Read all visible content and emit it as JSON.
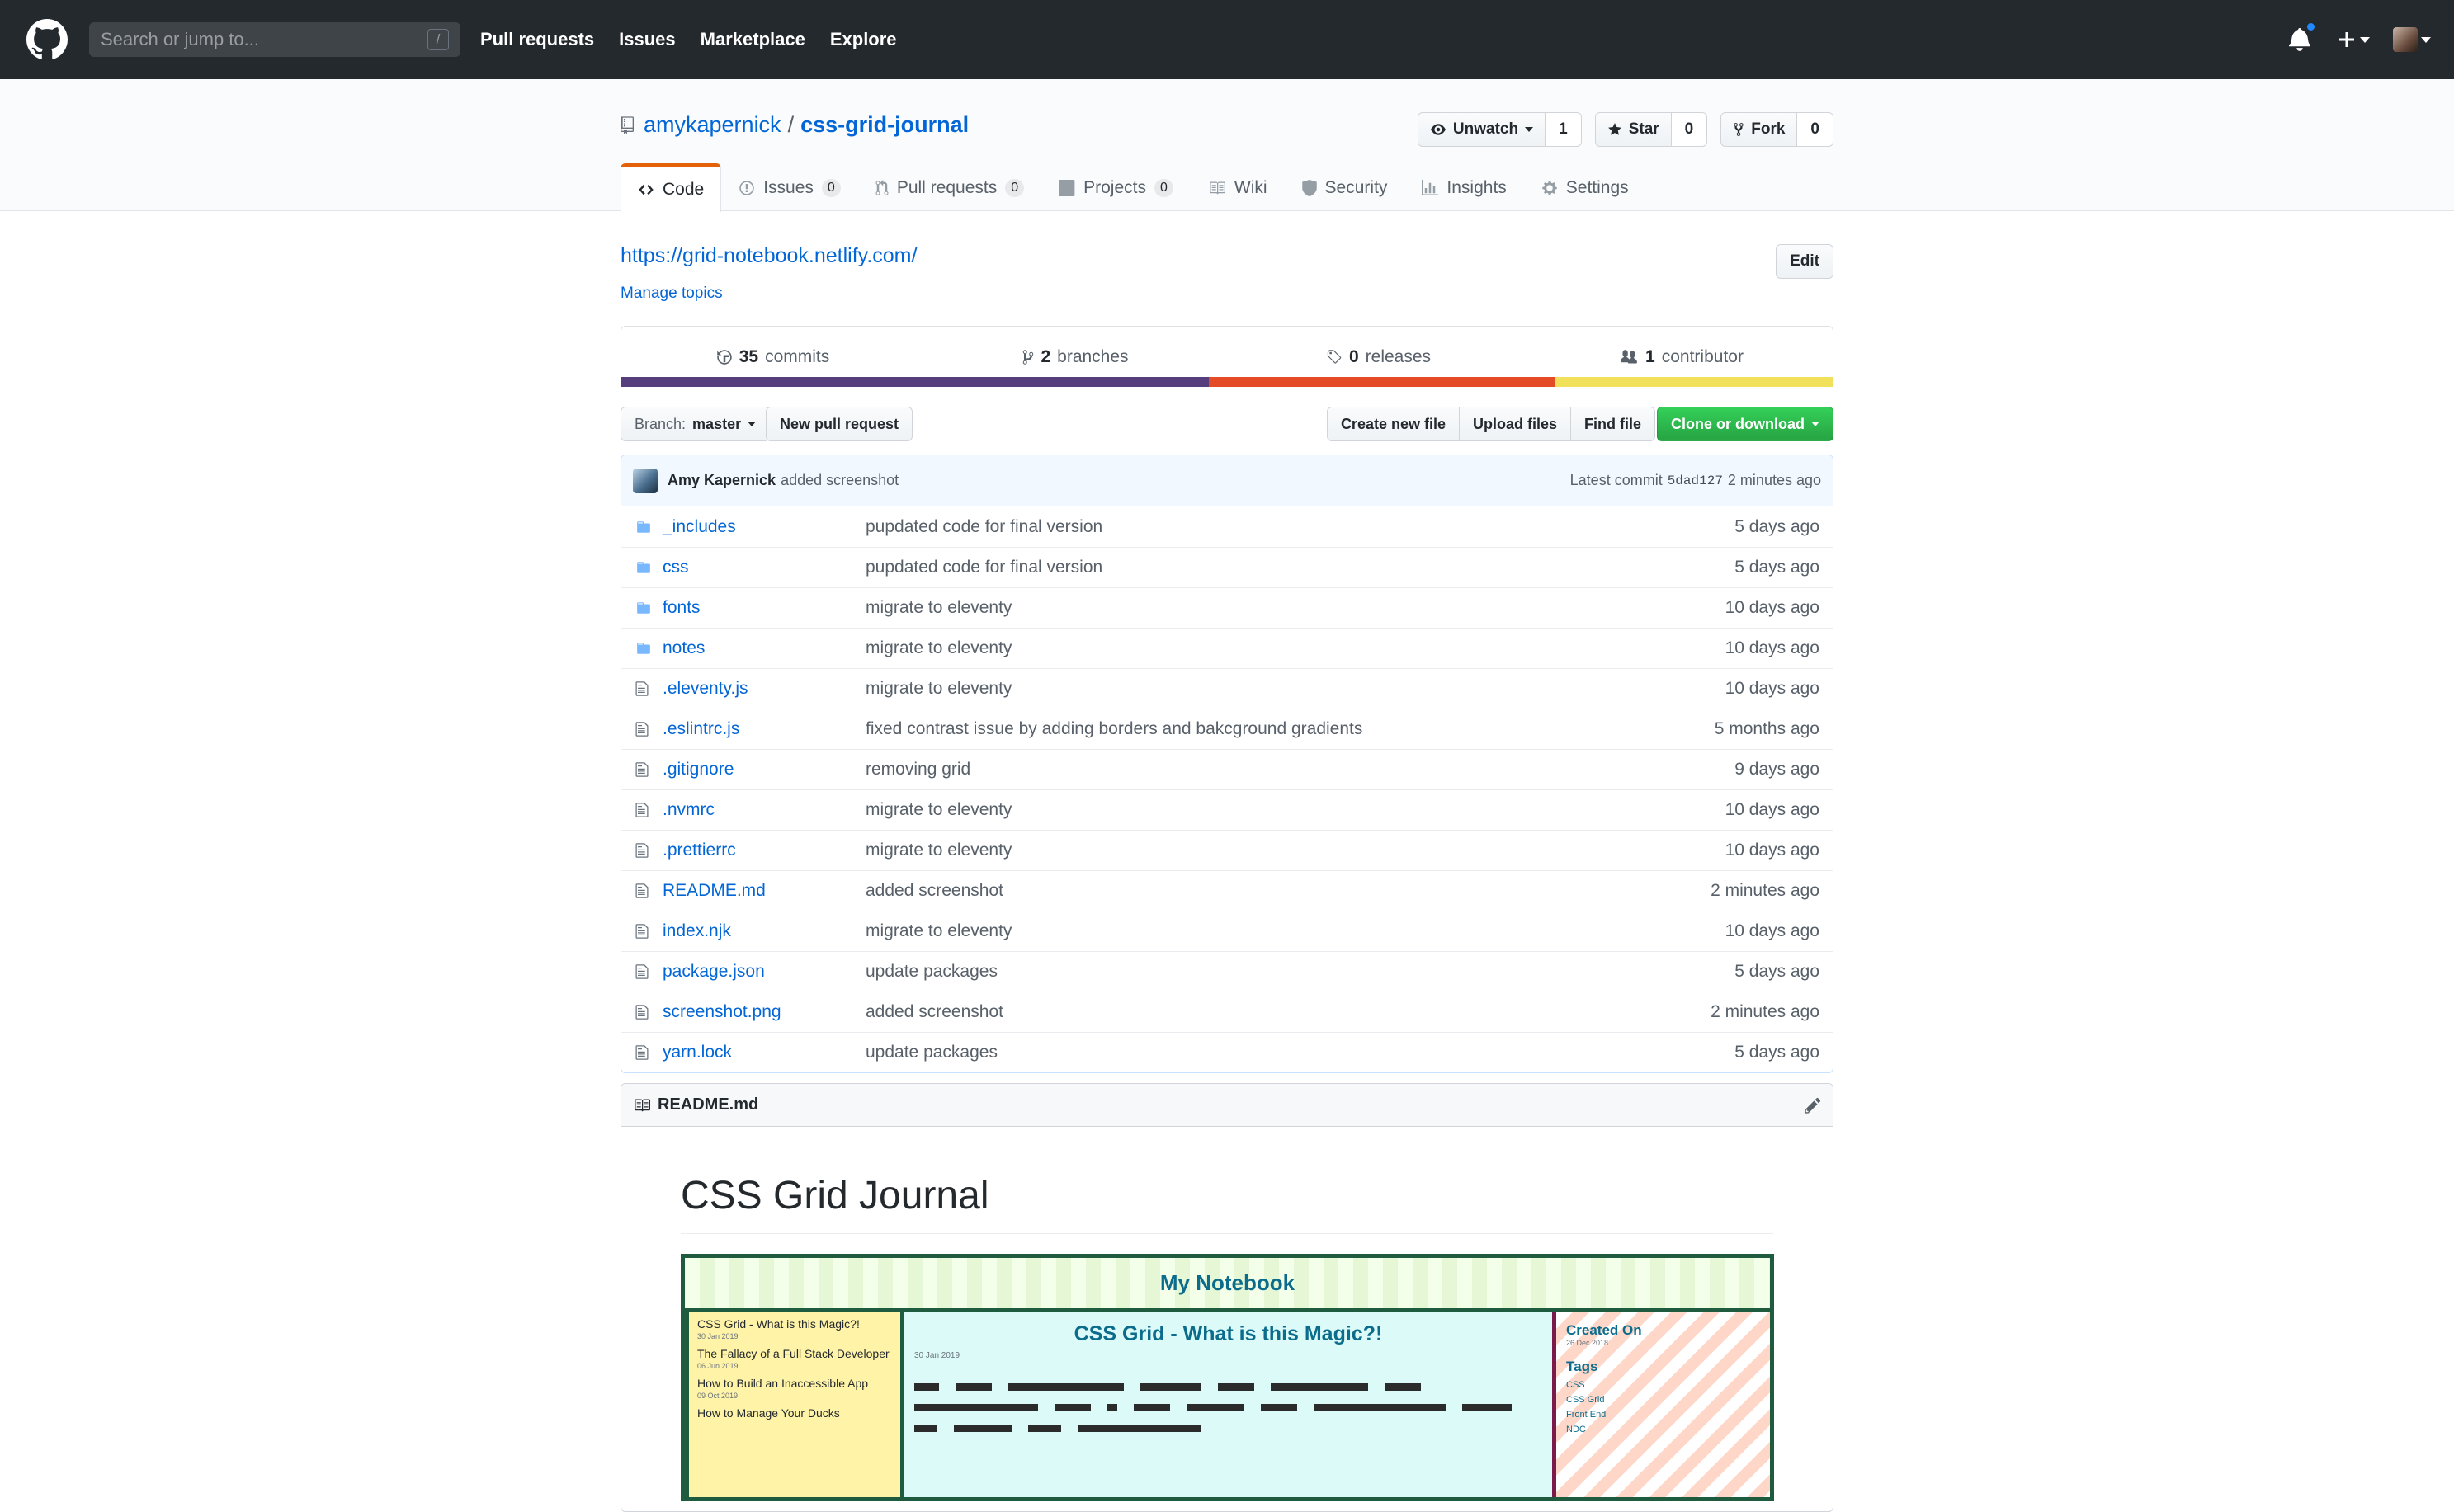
{
  "header": {
    "search_placeholder": "Search or jump to...",
    "slash_key": "/",
    "nav": [
      "Pull requests",
      "Issues",
      "Marketplace",
      "Explore"
    ]
  },
  "repo": {
    "owner": "amykapernick",
    "separator": "/",
    "name": "css-grid-journal",
    "actions": {
      "watch_label": "Unwatch",
      "watch_count": "1",
      "star_label": "Star",
      "star_count": "0",
      "fork_label": "Fork",
      "fork_count": "0"
    },
    "tabs": [
      {
        "label": "Code",
        "count": null,
        "icon": "code-icon"
      },
      {
        "label": "Issues",
        "count": "0",
        "icon": "issue-icon"
      },
      {
        "label": "Pull requests",
        "count": "0",
        "icon": "pull-request-icon"
      },
      {
        "label": "Projects",
        "count": "0",
        "icon": "project-icon"
      },
      {
        "label": "Wiki",
        "count": null,
        "icon": "book-icon"
      },
      {
        "label": "Security",
        "count": null,
        "icon": "shield-icon"
      },
      {
        "label": "Insights",
        "count": null,
        "icon": "graph-icon"
      },
      {
        "label": "Settings",
        "count": null,
        "icon": "gear-icon"
      }
    ]
  },
  "main": {
    "website": "https://grid-notebook.netlify.com/",
    "edit_label": "Edit",
    "manage_topics": "Manage topics",
    "numbers": {
      "commits_count": "35",
      "commits_label": "commits",
      "branches_count": "2",
      "branches_label": "branches",
      "releases_count": "0",
      "releases_label": "releases",
      "contributors_count": "1",
      "contributors_label": "contributor"
    },
    "languages": [
      {
        "color": "#563d7c",
        "percent": 48.5
      },
      {
        "color": "#e34c26",
        "percent": 28.6
      },
      {
        "color": "#f1e05a",
        "percent": 22.9
      }
    ],
    "branch_prefix": "Branch:",
    "branch_name": "master",
    "new_pr": "New pull request",
    "create_file": "Create new file",
    "upload_files": "Upload files",
    "find_file": "Find file",
    "clone": "Clone or download",
    "commit": {
      "author": "Amy Kapernick",
      "message": "added screenshot",
      "latest_label": "Latest commit",
      "sha": "5dad127",
      "age": "2 minutes ago"
    },
    "files": [
      {
        "type": "dir",
        "name": "_includes",
        "message": "pupdated code for final version",
        "age": "5 days ago"
      },
      {
        "type": "dir",
        "name": "css",
        "message": "pupdated code for final version",
        "age": "5 days ago"
      },
      {
        "type": "dir",
        "name": "fonts",
        "message": "migrate to eleventy",
        "age": "10 days ago"
      },
      {
        "type": "dir",
        "name": "notes",
        "message": "migrate to eleventy",
        "age": "10 days ago"
      },
      {
        "type": "file",
        "name": ".eleventy.js",
        "message": "migrate to eleventy",
        "age": "10 days ago"
      },
      {
        "type": "file",
        "name": ".eslintrc.js",
        "message": "fixed contrast issue by adding borders and bakcground gradients",
        "age": "5 months ago"
      },
      {
        "type": "file",
        "name": ".gitignore",
        "message": "removing grid",
        "age": "9 days ago"
      },
      {
        "type": "file",
        "name": ".nvmrc",
        "message": "migrate to eleventy",
        "age": "10 days ago"
      },
      {
        "type": "file",
        "name": ".prettierrc",
        "message": "migrate to eleventy",
        "age": "10 days ago"
      },
      {
        "type": "file",
        "name": "README.md",
        "message": "added screenshot",
        "age": "2 minutes ago"
      },
      {
        "type": "file",
        "name": "index.njk",
        "message": "migrate to eleventy",
        "age": "10 days ago"
      },
      {
        "type": "file",
        "name": "package.json",
        "message": "update packages",
        "age": "5 days ago"
      },
      {
        "type": "file",
        "name": "screenshot.png",
        "message": "added screenshot",
        "age": "2 minutes ago"
      },
      {
        "type": "file",
        "name": "yarn.lock",
        "message": "update packages",
        "age": "5 days ago"
      }
    ]
  },
  "readme": {
    "filename": "README.md",
    "title": "CSS Grid Journal",
    "screenshot": {
      "header": "My Notebook",
      "sidebar": [
        {
          "title": "CSS Grid - What is this Magic?!",
          "date": "30 Jan 2019"
        },
        {
          "title": "The Fallacy of a Full Stack Developer",
          "date": "06 Jun 2019"
        },
        {
          "title": "How to Build an Inaccessible App",
          "date": "09 Oct 2019"
        },
        {
          "title": "How to Manage Your Ducks",
          "date": ""
        }
      ],
      "main_title": "CSS Grid - What is this Magic?!",
      "main_date": "30 Jan 2019",
      "created_label": "Created On",
      "created_date": "26 Dec 2018",
      "tags_label": "Tags",
      "tags": [
        "CSS",
        "CSS Grid",
        "Front End",
        "NDC"
      ]
    }
  }
}
